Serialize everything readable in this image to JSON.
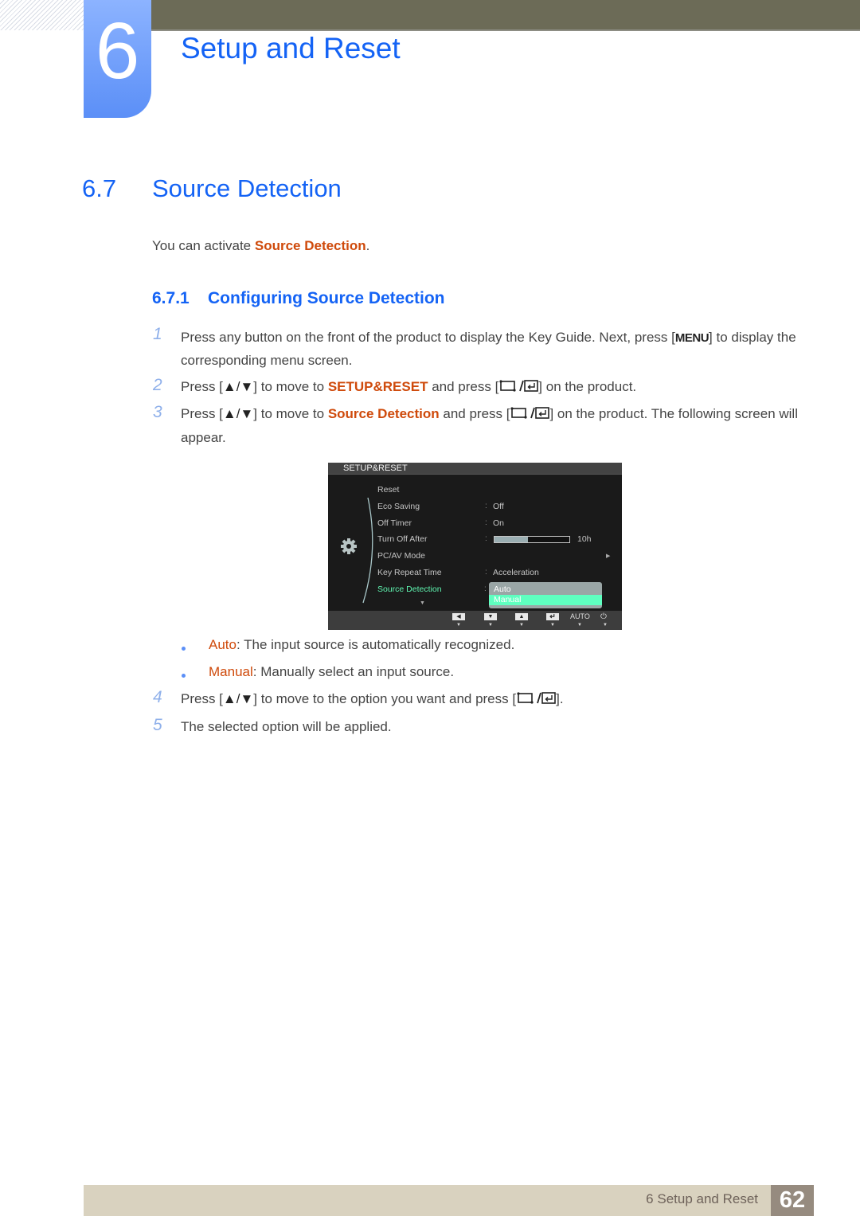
{
  "chapter": {
    "number": "6",
    "title": "Setup and Reset"
  },
  "section": {
    "number": "6.7",
    "title": "Source Detection"
  },
  "intro": {
    "prefix": "You can activate ",
    "highlight": "Source Detection",
    "suffix": "."
  },
  "subsection": {
    "number": "6.7.1",
    "title": "Configuring Source Detection"
  },
  "steps": [
    {
      "num": "1",
      "parts": [
        "Press any button on the front of the product to display the Key Guide. Next, press [",
        "MENU",
        "] to display the corresponding menu screen."
      ]
    },
    {
      "num": "2",
      "parts": [
        "Press [",
        "▲/▼",
        "] to move to ",
        "SETUP&RESET",
        " and press [",
        "] on the product."
      ]
    },
    {
      "num": "3",
      "parts": [
        "Press [",
        "▲/▼",
        "] to move to ",
        "Source Detection",
        " and press [",
        "] on the product. The following screen will appear."
      ]
    },
    {
      "num": "4",
      "parts": [
        "Press [",
        "▲/▼",
        "] to move to the option you want and press [",
        "]."
      ]
    },
    {
      "num": "5",
      "parts": [
        "The selected option will be applied."
      ]
    }
  ],
  "options": [
    {
      "name": "Auto",
      "desc": ": The input source is automatically recognized."
    },
    {
      "name": "Manual",
      "desc": ": Manually select an input source."
    }
  ],
  "osd": {
    "title": "SETUP&RESET",
    "rows": [
      {
        "label": "Reset",
        "value": ""
      },
      {
        "label": "Eco Saving",
        "value": "Off"
      },
      {
        "label": "Off Timer",
        "value": "On"
      },
      {
        "label": "Turn Off After",
        "value": "10h",
        "progress": 0.45
      },
      {
        "label": "PC/AV Mode",
        "value": ""
      },
      {
        "label": "Key Repeat Time",
        "value": "Acceleration"
      },
      {
        "label": "Source Detection",
        "value": ""
      }
    ],
    "dropdown": {
      "options": [
        "Auto",
        "Manual"
      ],
      "selected": "Manual"
    },
    "footer_buttons": [
      "left",
      "down",
      "up",
      "enter",
      "AUTO",
      "power"
    ],
    "icons": {
      "left": "◀",
      "down": "▼",
      "up": "▲",
      "enter": "↵",
      "power": "⏻",
      "tick": "▼",
      "more_right": "▶",
      "more_down": "▼"
    }
  },
  "footer": {
    "text": "6 Setup and Reset",
    "page": "62"
  },
  "colors": {
    "accent_blue": "#1463f5",
    "highlight_orange": "#cf4a0b",
    "osd_active": "#5ff5b0"
  }
}
